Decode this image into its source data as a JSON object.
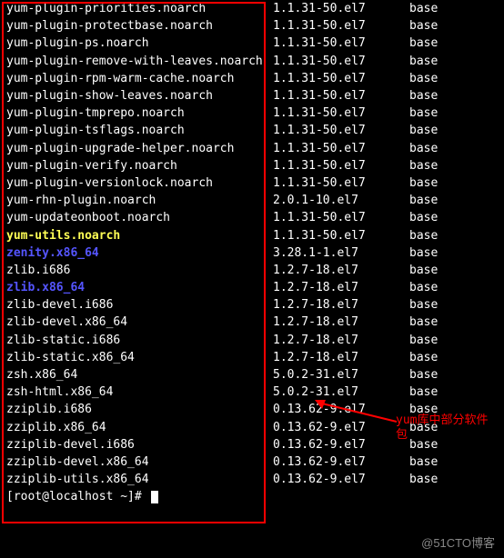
{
  "packages": [
    {
      "name": "yum-plugin-priorities.noarch",
      "version": "1.1.31-50.el7",
      "repo": "base",
      "color": "white"
    },
    {
      "name": "yum-plugin-protectbase.noarch",
      "version": "1.1.31-50.el7",
      "repo": "base",
      "color": "white"
    },
    {
      "name": "yum-plugin-ps.noarch",
      "version": "1.1.31-50.el7",
      "repo": "base",
      "color": "white"
    },
    {
      "name": "yum-plugin-remove-with-leaves.noarch",
      "version": "1.1.31-50.el7",
      "repo": "base",
      "color": "white"
    },
    {
      "name": "yum-plugin-rpm-warm-cache.noarch",
      "version": "1.1.31-50.el7",
      "repo": "base",
      "color": "white"
    },
    {
      "name": "yum-plugin-show-leaves.noarch",
      "version": "1.1.31-50.el7",
      "repo": "base",
      "color": "white"
    },
    {
      "name": "yum-plugin-tmprepo.noarch",
      "version": "1.1.31-50.el7",
      "repo": "base",
      "color": "white"
    },
    {
      "name": "yum-plugin-tsflags.noarch",
      "version": "1.1.31-50.el7",
      "repo": "base",
      "color": "white"
    },
    {
      "name": "yum-plugin-upgrade-helper.noarch",
      "version": "1.1.31-50.el7",
      "repo": "base",
      "color": "white"
    },
    {
      "name": "yum-plugin-verify.noarch",
      "version": "1.1.31-50.el7",
      "repo": "base",
      "color": "white"
    },
    {
      "name": "yum-plugin-versionlock.noarch",
      "version": "1.1.31-50.el7",
      "repo": "base",
      "color": "white"
    },
    {
      "name": "yum-rhn-plugin.noarch",
      "version": "2.0.1-10.el7",
      "repo": "base",
      "color": "white"
    },
    {
      "name": "yum-updateonboot.noarch",
      "version": "1.1.31-50.el7",
      "repo": "base",
      "color": "white"
    },
    {
      "name": "yum-utils.noarch",
      "version": "1.1.31-50.el7",
      "repo": "base",
      "color": "yellow"
    },
    {
      "name": "zenity.x86_64",
      "version": "3.28.1-1.el7",
      "repo": "base",
      "color": "blue"
    },
    {
      "name": "zlib.i686",
      "version": "1.2.7-18.el7",
      "repo": "base",
      "color": "white"
    },
    {
      "name": "zlib.x86_64",
      "version": "1.2.7-18.el7",
      "repo": "base",
      "color": "blue"
    },
    {
      "name": "zlib-devel.i686",
      "version": "1.2.7-18.el7",
      "repo": "base",
      "color": "white"
    },
    {
      "name": "zlib-devel.x86_64",
      "version": "1.2.7-18.el7",
      "repo": "base",
      "color": "white"
    },
    {
      "name": "zlib-static.i686",
      "version": "1.2.7-18.el7",
      "repo": "base",
      "color": "white"
    },
    {
      "name": "zlib-static.x86_64",
      "version": "1.2.7-18.el7",
      "repo": "base",
      "color": "white"
    },
    {
      "name": "zsh.x86_64",
      "version": "5.0.2-31.el7",
      "repo": "base",
      "color": "white"
    },
    {
      "name": "zsh-html.x86_64",
      "version": "5.0.2-31.el7",
      "repo": "base",
      "color": "white"
    },
    {
      "name": "zziplib.i686",
      "version": "0.13.62-9.el7",
      "repo": "base",
      "color": "white"
    },
    {
      "name": "zziplib.x86_64",
      "version": "0.13.62-9.el7",
      "repo": "base",
      "color": "white"
    },
    {
      "name": "zziplib-devel.i686",
      "version": "0.13.62-9.el7",
      "repo": "base",
      "color": "white"
    },
    {
      "name": "zziplib-devel.x86_64",
      "version": "0.13.62-9.el7",
      "repo": "base",
      "color": "white"
    },
    {
      "name": "zziplib-utils.x86_64",
      "version": "0.13.62-9.el7",
      "repo": "base",
      "color": "white"
    }
  ],
  "prompt": "[root@localhost ~]# ",
  "annotation_text_line1": "yum库中部分软件",
  "annotation_text_line2": "包",
  "watermark": "@51CTO博客"
}
